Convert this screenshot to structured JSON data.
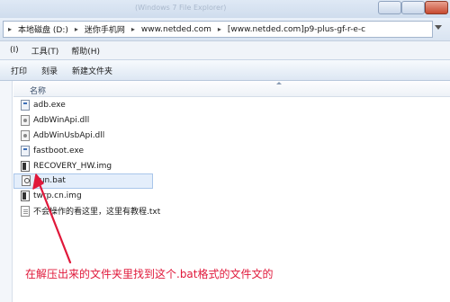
{
  "window": {
    "title": "(Windows 7 File Explorer)"
  },
  "addressbar": {
    "crumbs": [
      "本地磁盘 (D:)",
      "迷你手机网",
      "www.netded.com",
      "[www.netded.com]p9-plus-gf-r-e-c"
    ]
  },
  "menubar": {
    "items": [
      "(I)",
      "工具(T)",
      "帮助(H)"
    ]
  },
  "toolbar": {
    "buttons": [
      "打印",
      "刻录",
      "新建文件夹"
    ]
  },
  "list": {
    "column_header": "名称",
    "files": [
      {
        "name": "adb.exe",
        "icon": "exe-icon"
      },
      {
        "name": "AdbWinApi.dll",
        "icon": "dll-icon"
      },
      {
        "name": "AdbWinUsbApi.dll",
        "icon": "dll-icon"
      },
      {
        "name": "fastboot.exe",
        "icon": "exe-icon"
      },
      {
        "name": "RECOVERY_HW.img",
        "icon": "img-icon"
      },
      {
        "name": "Run.bat",
        "icon": "bat-icon"
      },
      {
        "name": "twrp.cn.img",
        "icon": "img-icon"
      },
      {
        "name": "不会操作的看这里，这里有教程.txt",
        "icon": "txt-icon"
      }
    ],
    "selected_index": 5
  },
  "annotation": {
    "text": "在解压出来的文件夹里找到这个.bat格式的文件文的",
    "color": "#e0183a"
  }
}
